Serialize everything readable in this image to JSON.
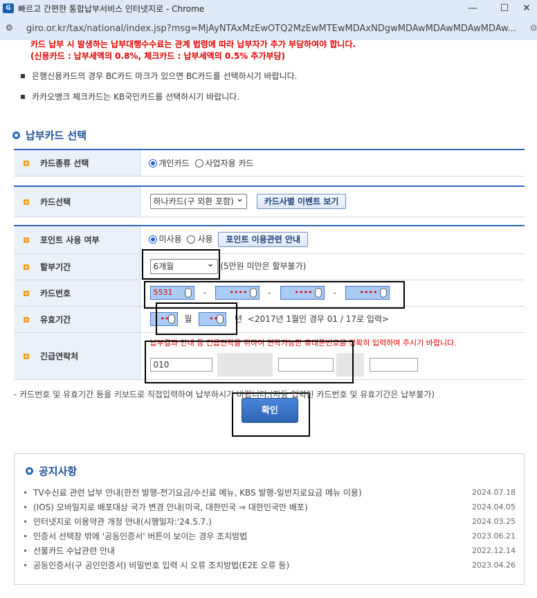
{
  "window": {
    "title": "빠르고 간편한 통합납부서비스 인터넷지로 - Chrome",
    "url": "giro.or.kr/tax/national/index.jsp?msg=MjAyNTAxMzEwOTQ2MzEwMTEwMDAxNDgwMDAwMDAwMDAwMDAw..."
  },
  "notices_top": {
    "line1": "카드 납부 시 발생하는 납부대행수수료는 관계 법령에 따라 납부자가 추가 부담하여야 합니다.",
    "line2": "(신용카드 : 납부세액의 0.8%, 체크카드 : 납부세액의 0.5% 추가부담)",
    "bullet1": "은행신용카드의 경우 BC카드 마크가 있으면 BC카드를 선택하시기 바랍니다.",
    "bullet2": "카카오뱅크 체크카드는 KB국민카드를 선택하시기 바랍니다."
  },
  "section_title": "납부카드 선택",
  "form": {
    "card_type_label": "카드종류 선택",
    "card_type_personal": "개인카드",
    "card_type_business": "사업자용 카드",
    "card_select_label": "카드선택",
    "card_select_value": "하나카드(구 외환 포함)",
    "card_event_button": "카드사별 이벤트 보기",
    "points_label": "포인트 사용 여부",
    "points_no": "미사용",
    "points_yes": "사용",
    "points_info_button": "포인트 이용관련 안내",
    "installment_label": "할부기간",
    "installment_value": "6개월",
    "installment_note": "(5만원 미만은 할부불가)",
    "card_number_label": "카드번호",
    "card_number_parts": [
      "5531",
      "••••",
      "••••",
      "••••"
    ],
    "expiry_label": "유효기간",
    "expiry_month": "••",
    "expiry_month_unit": "월",
    "expiry_year": "••",
    "expiry_year_unit": "년",
    "expiry_note": "<2017년 1월인 경우 01 / 17로 입력>",
    "emergency_label": "긴급연락처",
    "emergency_note": "납부결과 안내 등 긴급연락을 위하여 연락가능한 휴대폰번호를 정확히 입력하여 주시기 바랍니다.",
    "phone_prefix": "010"
  },
  "footnote": "- 카드번호 및 유효기간 등을 키보드로 직접입력하여 납부하시기 바랍니다.(자동 입력된 카드번호 및 유효기간은 납부불가)",
  "confirm_button": "확인",
  "notice_board": {
    "title": "공지사항",
    "items": [
      {
        "text": "TV수신료 관련 납부 안내(한전 발행-전기요금/수신료 메뉴, KBS 발행-일반지로요금 메뉴 이용)",
        "date": "2024.07.18"
      },
      {
        "text": "(IOS) 모바일지로 배포대상 국가 변경 안내(미국, 대한민국 ⇒ 대한민국만 배포)",
        "date": "2024.04.05"
      },
      {
        "text": "인터넷지로 이용약관 개정 안내(시행일자:'24.5.7.)",
        "date": "2024.03.25"
      },
      {
        "text": "인증서 선택창 밖에 '공동인증서' 버튼이 보이는 경우 조치방법",
        "date": "2023.06.21"
      },
      {
        "text": "선불카드 수납관련 안내",
        "date": "2022.12.14"
      },
      {
        "text": "공동인증서(구 공인인증서) 비밀번호 입력 시 오류 조치방법(E2E 오류 등)",
        "date": "2023.04.26"
      }
    ]
  }
}
